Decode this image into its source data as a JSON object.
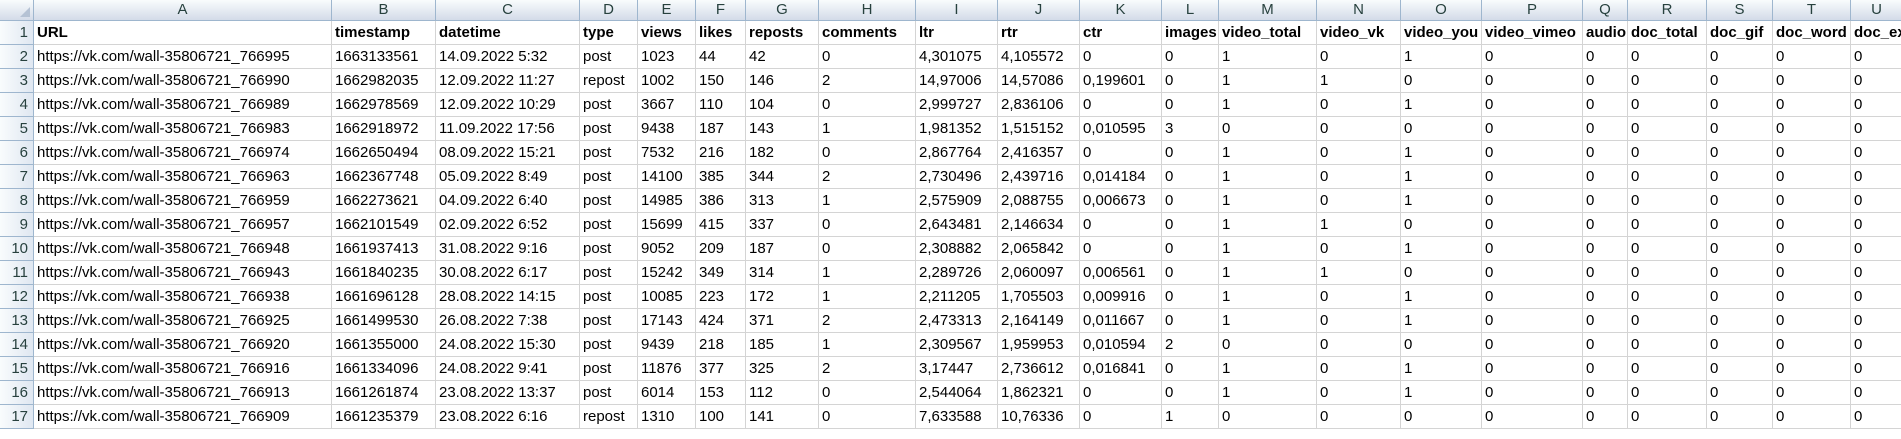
{
  "columns": [
    "A",
    "B",
    "C",
    "D",
    "E",
    "F",
    "G",
    "H",
    "I",
    "J",
    "K",
    "L",
    "M",
    "N",
    "O",
    "P",
    "Q",
    "R",
    "S",
    "T",
    "U"
  ],
  "row_numbers": [
    "1",
    "2",
    "3",
    "4",
    "5",
    "6",
    "7",
    "8",
    "9",
    "10",
    "11",
    "12",
    "13",
    "14",
    "15",
    "16",
    "17"
  ],
  "header_row": [
    "URL",
    "timestamp",
    "datetime",
    "type",
    "views",
    "likes",
    "reposts",
    "comments",
    "ltr",
    "rtr",
    "ctr",
    "images",
    "video_total",
    "video_vk",
    "video_you",
    "video_vimeo",
    "audio",
    "doc_total",
    "doc_gif",
    "doc_word",
    "doc_ex"
  ],
  "rows": [
    [
      "https://vk.com/wall-35806721_766995",
      "1663133561",
      "14.09.2022 5:32",
      "post",
      "1023",
      "44",
      "42",
      "0",
      "4,301075",
      "4,105572",
      "0",
      "0",
      "1",
      "0",
      "1",
      "0",
      "0",
      "0",
      "0",
      "0",
      "0"
    ],
    [
      "https://vk.com/wall-35806721_766990",
      "1662982035",
      "12.09.2022 11:27",
      "repost",
      "1002",
      "150",
      "146",
      "2",
      "14,97006",
      "14,57086",
      "0,199601",
      "0",
      "1",
      "1",
      "0",
      "0",
      "0",
      "0",
      "0",
      "0",
      "0"
    ],
    [
      "https://vk.com/wall-35806721_766989",
      "1662978569",
      "12.09.2022 10:29",
      "post",
      "3667",
      "110",
      "104",
      "0",
      "2,999727",
      "2,836106",
      "0",
      "0",
      "1",
      "0",
      "1",
      "0",
      "0",
      "0",
      "0",
      "0",
      "0"
    ],
    [
      "https://vk.com/wall-35806721_766983",
      "1662918972",
      "11.09.2022 17:56",
      "post",
      "9438",
      "187",
      "143",
      "1",
      "1,981352",
      "1,515152",
      "0,010595",
      "3",
      "0",
      "0",
      "0",
      "0",
      "0",
      "0",
      "0",
      "0",
      "0"
    ],
    [
      "https://vk.com/wall-35806721_766974",
      "1662650494",
      "08.09.2022 15:21",
      "post",
      "7532",
      "216",
      "182",
      "0",
      "2,867764",
      "2,416357",
      "0",
      "0",
      "1",
      "0",
      "1",
      "0",
      "0",
      "0",
      "0",
      "0",
      "0"
    ],
    [
      "https://vk.com/wall-35806721_766963",
      "1662367748",
      "05.09.2022 8:49",
      "post",
      "14100",
      "385",
      "344",
      "2",
      "2,730496",
      "2,439716",
      "0,014184",
      "0",
      "1",
      "0",
      "1",
      "0",
      "0",
      "0",
      "0",
      "0",
      "0"
    ],
    [
      "https://vk.com/wall-35806721_766959",
      "1662273621",
      "04.09.2022 6:40",
      "post",
      "14985",
      "386",
      "313",
      "1",
      "2,575909",
      "2,088755",
      "0,006673",
      "0",
      "1",
      "0",
      "1",
      "0",
      "0",
      "0",
      "0",
      "0",
      "0"
    ],
    [
      "https://vk.com/wall-35806721_766957",
      "1662101549",
      "02.09.2022 6:52",
      "post",
      "15699",
      "415",
      "337",
      "0",
      "2,643481",
      "2,146634",
      "0",
      "0",
      "1",
      "1",
      "0",
      "0",
      "0",
      "0",
      "0",
      "0",
      "0"
    ],
    [
      "https://vk.com/wall-35806721_766948",
      "1661937413",
      "31.08.2022 9:16",
      "post",
      "9052",
      "209",
      "187",
      "0",
      "2,308882",
      "2,065842",
      "0",
      "0",
      "1",
      "0",
      "1",
      "0",
      "0",
      "0",
      "0",
      "0",
      "0"
    ],
    [
      "https://vk.com/wall-35806721_766943",
      "1661840235",
      "30.08.2022 6:17",
      "post",
      "15242",
      "349",
      "314",
      "1",
      "2,289726",
      "2,060097",
      "0,006561",
      "0",
      "1",
      "1",
      "0",
      "0",
      "0",
      "0",
      "0",
      "0",
      "0"
    ],
    [
      "https://vk.com/wall-35806721_766938",
      "1661696128",
      "28.08.2022 14:15",
      "post",
      "10085",
      "223",
      "172",
      "1",
      "2,211205",
      "1,705503",
      "0,009916",
      "0",
      "1",
      "0",
      "1",
      "0",
      "0",
      "0",
      "0",
      "0",
      "0"
    ],
    [
      "https://vk.com/wall-35806721_766925",
      "1661499530",
      "26.08.2022 7:38",
      "post",
      "17143",
      "424",
      "371",
      "2",
      "2,473313",
      "2,164149",
      "0,011667",
      "0",
      "1",
      "0",
      "1",
      "0",
      "0",
      "0",
      "0",
      "0",
      "0"
    ],
    [
      "https://vk.com/wall-35806721_766920",
      "1661355000",
      "24.08.2022 15:30",
      "post",
      "9439",
      "218",
      "185",
      "1",
      "2,309567",
      "1,959953",
      "0,010594",
      "2",
      "0",
      "0",
      "0",
      "0",
      "0",
      "0",
      "0",
      "0",
      "0"
    ],
    [
      "https://vk.com/wall-35806721_766916",
      "1661334096",
      "24.08.2022 9:41",
      "post",
      "11876",
      "377",
      "325",
      "2",
      "3,17447",
      "2,736612",
      "0,016841",
      "0",
      "1",
      "0",
      "1",
      "0",
      "0",
      "0",
      "0",
      "0",
      "0"
    ],
    [
      "https://vk.com/wall-35806721_766913",
      "1661261874",
      "23.08.2022 13:37",
      "post",
      "6014",
      "153",
      "112",
      "0",
      "2,544064",
      "1,862321",
      "0",
      "0",
      "1",
      "0",
      "1",
      "0",
      "0",
      "0",
      "0",
      "0",
      "0"
    ],
    [
      "https://vk.com/wall-35806721_766909",
      "1661235379",
      "23.08.2022 6:16",
      "repost",
      "1310",
      "100",
      "141",
      "0",
      "7,633588",
      "10,76336",
      "0",
      "1",
      "0",
      "0",
      "0",
      "0",
      "0",
      "0",
      "0",
      "0",
      "0"
    ]
  ]
}
